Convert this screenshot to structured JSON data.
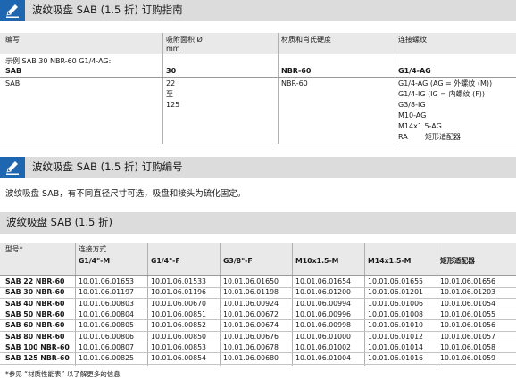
{
  "section1": {
    "title": "波纹吸盘 SAB (1.5 折) 订购指南",
    "headers": [
      "编写",
      "吸附面积 Ø",
      "mm",
      "材质和肖氏硬度",
      "连接螺纹"
    ],
    "example_label": "示例 SAB 30 NBR-60 G1/4-AG:",
    "example_row": [
      "SAB",
      "30",
      "NBR-60",
      "G1/4-AG"
    ],
    "row": {
      "col1": "SAB",
      "sizes": [
        "22",
        "至",
        "125"
      ],
      "material": "NBR-60",
      "threads": [
        "G1/4-AG (AG = 外螺纹 (M))",
        "G1/4-IG (IG = 内螺纹 (F))",
        "G3/8-IG",
        "M10-AG",
        "M14x1.5-AG",
        "RA"
      ],
      "ra_desc": "矩形适配器"
    }
  },
  "section2": {
    "title": "波纹吸盘 SAB (1.5 折) 订购编号",
    "text": "波纹吸盘 SAB，有不同直径尺寸可选，吸盘和接头为硫化固定。"
  },
  "section3": {
    "title": "波纹吸盘 SAB (1.5 折)",
    "col_type": "型号*",
    "col_conn": "连接方式",
    "headers": [
      "G1/4\"-M",
      "G1/4\"-F",
      "G3/8\"-F",
      "M10x1.5-M",
      "M14x1.5-M",
      "矩形适配器"
    ],
    "rows": [
      [
        "SAB 22 NBR-60",
        "10.01.06.01653",
        "10.01.06.01533",
        "10.01.06.01650",
        "10.01.06.01654",
        "10.01.06.01655",
        "10.01.06.01656"
      ],
      [
        "SAB 30 NBR-60",
        "10.01.06.01197",
        "10.01.06.01196",
        "10.01.06.01198",
        "10.01.06.01200",
        "10.01.06.01201",
        "10.01.06.01203"
      ],
      [
        "SAB 40 NBR-60",
        "10.01.06.00803",
        "10.01.06.00670",
        "10.01.06.00924",
        "10.01.06.00994",
        "10.01.06.01006",
        "10.01.06.01054"
      ],
      [
        "SAB 50 NBR-60",
        "10.01.06.00804",
        "10.01.06.00851",
        "10.01.06.00672",
        "10.01.06.00996",
        "10.01.06.01008",
        "10.01.06.01055"
      ],
      [
        "SAB 60 NBR-60",
        "10.01.06.00805",
        "10.01.06.00852",
        "10.01.06.00674",
        "10.01.06.00998",
        "10.01.06.01010",
        "10.01.06.01056"
      ],
      [
        "SAB 80 NBR-60",
        "10.01.06.00806",
        "10.01.06.00850",
        "10.01.06.00676",
        "10.01.06.01000",
        "10.01.06.01012",
        "10.01.06.01057"
      ],
      [
        "SAB 100 NBR-60",
        "10.01.06.00807",
        "10.01.06.00853",
        "10.01.06.00678",
        "10.01.06.01002",
        "10.01.06.01014",
        "10.01.06.01058"
      ],
      [
        "SAB 125 NBR-60",
        "10.01.06.00825",
        "10.01.06.00854",
        "10.01.06.00680",
        "10.01.06.01004",
        "10.01.06.01016",
        "10.01.06.01059"
      ]
    ],
    "footnote": "*参见 “材质性能表” 以了解更多的信息"
  }
}
